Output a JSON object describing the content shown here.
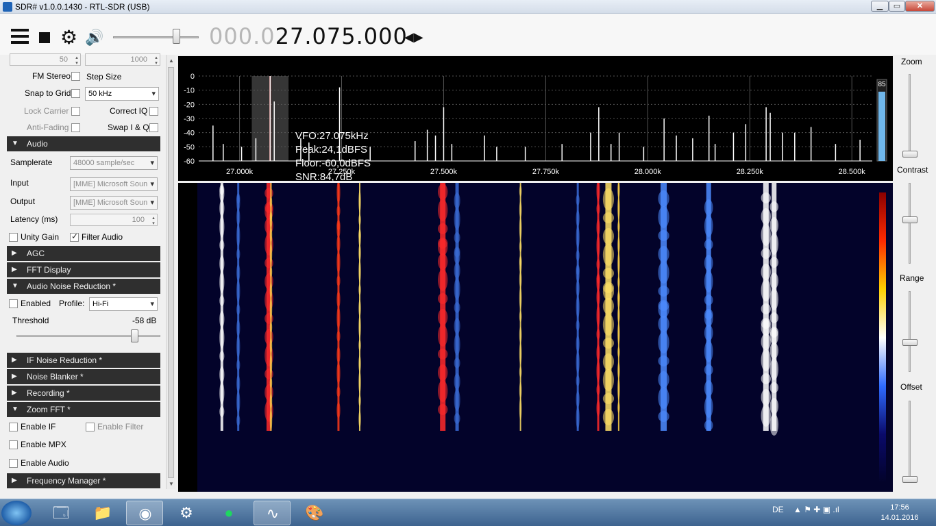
{
  "window": {
    "title": "SDR# v1.0.0.1430 - RTL-SDR (USB)",
    "min": "▁",
    "max": "▭",
    "close": "✕"
  },
  "toolbar": {
    "freq_dim": "000.0",
    "freq_bright": "27.075.000",
    "arrows": "◀▶"
  },
  "left": {
    "spin1": "50",
    "spin2": "1000",
    "fm_stereo": "FM Stereo",
    "step_size": "Step Size",
    "snap_to_grid": "Snap to Grid",
    "step_value": "50 kHz",
    "lock_carrier": "Lock Carrier",
    "correct_iq": "Correct IQ",
    "anti_fading": "Anti-Fading",
    "swap_iq": "Swap I & Q",
    "sections": {
      "audio": "Audio",
      "agc": "AGC",
      "fft_display": "FFT Display",
      "anr": "Audio Noise Reduction *",
      "ifnr": "IF Noise Reduction *",
      "noise_blanker": "Noise Blanker *",
      "recording": "Recording *",
      "zoom_fft": "Zoom FFT *",
      "freq_manager": "Frequency Manager *"
    },
    "samplerate_label": "Samplerate",
    "samplerate_value": "48000 sample/sec",
    "input_label": "Input",
    "input_value": "[MME] Microsoft Soun",
    "output_label": "Output",
    "output_value": "[MME] Microsoft Soun",
    "latency_label": "Latency (ms)",
    "latency_value": "100",
    "unity_gain": "Unity Gain",
    "filter_audio": "Filter Audio",
    "enabled": "Enabled",
    "profile_label": "Profile:",
    "profile_value": "Hi-Fi",
    "threshold_label": "Threshold",
    "threshold_value": "-58 dB",
    "threshold_level": 0.85,
    "enable_if": "Enable IF",
    "enable_filter": "Enable Filter",
    "enable_mpx": "Enable MPX",
    "enable_audio": "Enable Audio"
  },
  "spectrum": {
    "y_ticks": [
      "0",
      "-10",
      "-20",
      "-30",
      "-40",
      "-50",
      "-60"
    ],
    "x_ticks": [
      "27.000k",
      "27.250k",
      "27.500k",
      "27.750k",
      "28.000k",
      "28.250k",
      "28.500k"
    ],
    "x_ticks_values": [
      27000,
      27250,
      27500,
      27750,
      28000,
      28250,
      28500
    ],
    "vfo": "VFO:27.075kHz",
    "peak": "Peak:24,1dBFS",
    "floor": "Floor:-60,0dBFS",
    "snr": "SNR:84,7dB",
    "level_value": "85",
    "level_fraction": 0.85,
    "colors": {
      "trace": "#ffffff",
      "grid": "#555555",
      "filter": "#5a5a5a",
      "vfo": "#ff4a4a",
      "meter": "#6fb6ea"
    }
  },
  "chart_data": {
    "type": "line",
    "title": "",
    "xlabel": "",
    "ylabel": "",
    "xlim": [
      26900,
      28550
    ],
    "ylim": [
      -60,
      0
    ],
    "grid": true,
    "series": [
      {
        "x": [
          26935,
          26960,
          27005,
          27040,
          27075,
          27085,
          27150,
          27170,
          27245,
          27320,
          27430,
          27460,
          27480,
          27500,
          27520,
          27600,
          27630,
          27700,
          27790,
          27860,
          27880,
          27910,
          27930,
          27990,
          28040,
          28070,
          28110,
          28150,
          28165,
          28210,
          28240,
          28290,
          28300,
          28330,
          28360,
          28400,
          28460,
          28520
        ],
        "y": [
          -35,
          -48,
          -50,
          -44,
          0,
          -18,
          -44,
          -47,
          -8,
          -50,
          -46,
          -38,
          -42,
          -22,
          -48,
          -42,
          -50,
          -50,
          -48,
          -40,
          -22,
          -48,
          -40,
          -50,
          -30,
          -42,
          -44,
          -28,
          -48,
          -40,
          -34,
          -22,
          -26,
          -40,
          -40,
          -36,
          -48,
          -45
        ]
      }
    ]
  },
  "waterfall": {
    "lanes": [
      {
        "f": 26960,
        "c": "#ffffff",
        "w": 4
      },
      {
        "f": 27000,
        "c": "#3a6bd6",
        "w": 3
      },
      {
        "f": 27075,
        "c": "#ff2a2a",
        "w": 7
      },
      {
        "f": 27080,
        "c": "#ffd34a",
        "w": 2
      },
      {
        "f": 27245,
        "c": "#ff3b1a",
        "w": 3
      },
      {
        "f": 27297,
        "c": "#ffe066",
        "w": 2
      },
      {
        "f": 27500,
        "c": "#ff2a2a",
        "w": 8
      },
      {
        "f": 27535,
        "c": "#3a6bd6",
        "w": 5
      },
      {
        "f": 27690,
        "c": "#ffe066",
        "w": 2
      },
      {
        "f": 27830,
        "c": "#3a6bd6",
        "w": 3
      },
      {
        "f": 27880,
        "c": "#ff2a2a",
        "w": 3
      },
      {
        "f": 27905,
        "c": "#ffe066",
        "w": 9
      },
      {
        "f": 27930,
        "c": "#ffd34a",
        "w": 2
      },
      {
        "f": 28040,
        "c": "#4d8cff",
        "w": 9
      },
      {
        "f": 28150,
        "c": "#4d8cff",
        "w": 7
      },
      {
        "f": 28290,
        "c": "#ffffff",
        "w": 8
      },
      {
        "f": 28310,
        "c": "#ffffff",
        "w": 7
      }
    ],
    "colormap": [
      "#8a0000",
      "#ff2a00",
      "#ffd000",
      "#ffffff",
      "#2f6bff",
      "#0a0a6a",
      "#03032a"
    ]
  },
  "right": {
    "zoom": "Zoom",
    "contrast": "Contrast",
    "range": "Range",
    "offset": "Offset",
    "zoom_level": 0.0,
    "contrast_level": 0.55,
    "range_level": 0.35,
    "offset_level": 0.0
  },
  "taskbar": {
    "lang": "DE",
    "time": "17:56",
    "date": "14.01.2016",
    "tray_icons": "▲  ⚑  ✚  ▣  .ıl",
    "apps": [
      "explorer-icon",
      "folder-icon",
      "chrome-icon",
      "steam-icon",
      "spotify-icon",
      "sdr-icon",
      "paint-icon"
    ]
  }
}
